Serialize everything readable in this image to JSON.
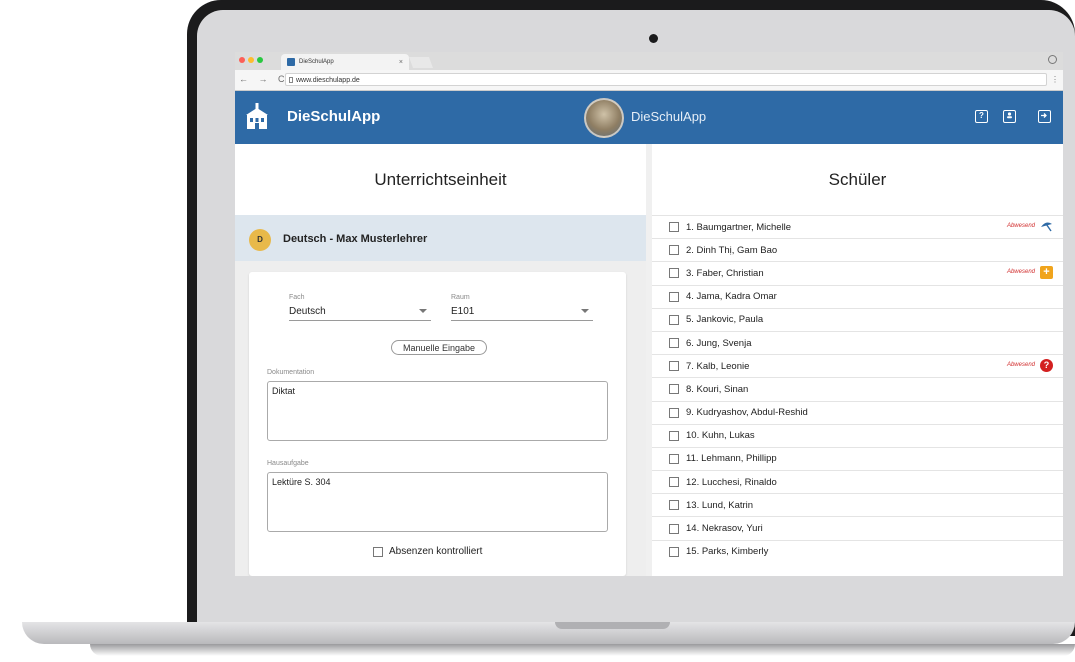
{
  "browser": {
    "tab_title": "DieSchulApp",
    "tab_close": "×",
    "url": "www.dieschulapp.de",
    "nav_glyphs": "← → C"
  },
  "app": {
    "name": "DieSchulApp",
    "center_title": "DieSchulApp",
    "header_icons": [
      "help-icon",
      "account-icon",
      "logout-icon"
    ],
    "brand_color": "#2e6aa6"
  },
  "left_panel": {
    "title": "Unterrichtseinheit",
    "lesson": {
      "badge": "D",
      "title": "Deutsch - Max Musterlehrer"
    },
    "fach_label": "Fach",
    "fach_value": "Deutsch",
    "raum_label": "Raum",
    "raum_value": "E101",
    "manual_button": "Manuelle Eingabe",
    "doku_label": "Dokumentation",
    "doku_value": "Diktat",
    "haus_label": "Hausaufgabe",
    "haus_value": "Lektüre S. 304",
    "absenzen_label": "Absenzen kontrolliert"
  },
  "right_panel": {
    "title": "Schüler",
    "absent_label": "Abwesend",
    "students": [
      {
        "name": "1. Baumgartner, Michelle",
        "absent": true,
        "icon": "umbrella-icon"
      },
      {
        "name": "2. Dinh Thị, Gam Bao",
        "absent": false
      },
      {
        "name": "3. Faber, Christian",
        "absent": true,
        "icon": "medical-plus-icon"
      },
      {
        "name": "4. Jama, Kadra Omar",
        "absent": false
      },
      {
        "name": "5. Jankovic, Paula",
        "absent": false
      },
      {
        "name": "6. Jung, Svenja",
        "absent": false
      },
      {
        "name": "7. Kalb, Leonie",
        "absent": true,
        "icon": "question-icon"
      },
      {
        "name": "8. Kouri, Sinan",
        "absent": false
      },
      {
        "name": "9. Kudryashov, Abdul-Reshid",
        "absent": false
      },
      {
        "name": "10. Kuhn, Lukas",
        "absent": false
      },
      {
        "name": "11. Lehmann, Phillipp",
        "absent": false
      },
      {
        "name": "12. Lucchesi, Rinaldo",
        "absent": false
      },
      {
        "name": "13. Lund, Katrin",
        "absent": false
      },
      {
        "name": "14. Nekrasov, Yuri",
        "absent": false
      },
      {
        "name": "15. Parks, Kimberly",
        "absent": false
      }
    ]
  }
}
